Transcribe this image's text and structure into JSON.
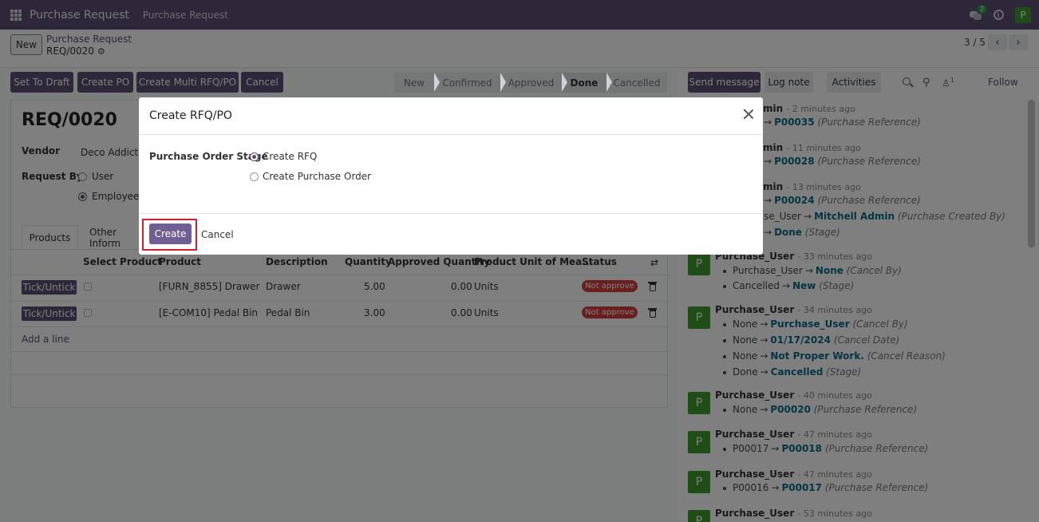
{
  "navbar": {
    "app_title": "Purchase Request",
    "menu_item": "Purchase Request",
    "chat_count": "2",
    "user_initial": "P"
  },
  "control": {
    "new_label": "New",
    "breadcrumb_parent": "Purchase Request",
    "breadcrumb_current": "REQ/0020",
    "pager": "3 / 5"
  },
  "actions": {
    "set_draft": "Set To Draft",
    "create_po": "Create PO",
    "create_multi": "Create Multi RFQ/PO",
    "cancel": "Cancel"
  },
  "stages": [
    "New",
    "Confirmed",
    "Approved",
    "Done",
    "Cancelled"
  ],
  "active_stage": "Done",
  "form": {
    "name": "REQ/0020",
    "vendor_label": "Vendor",
    "vendor_value": "Deco Addict",
    "request_by_label": "Request By",
    "request_by_options": [
      "User",
      "Employee"
    ],
    "request_by_selected": "Employee",
    "tabs": [
      "Products",
      "Other Inform"
    ]
  },
  "table": {
    "headers": [
      "Select Product",
      "Product",
      "Description",
      "Quantity",
      "Approved Quantity",
      "Product Unit of Mea...",
      "Status"
    ],
    "rows": [
      {
        "btn": "Tick/Untick",
        "product": "[FURN_8855] Drawer",
        "description": "Drawer",
        "quantity": "5.00",
        "approved": "0.00",
        "uom": "Units",
        "status": "Not approve"
      },
      {
        "btn": "Tick/Untick",
        "product": "[E-COM10] Pedal Bin",
        "description": "Pedal Bin",
        "quantity": "3.00",
        "approved": "0.00",
        "uom": "Units",
        "status": "Not approve"
      }
    ],
    "add_line": "Add a line"
  },
  "chatter": {
    "send_message": "Send message",
    "log_note": "Log note",
    "activities": "Activities",
    "follow": "Follow",
    "followers": "1",
    "messages": [
      {
        "author": "min",
        "time": "- 2 minutes ago",
        "tracks": [
          {
            "old": "",
            "new": "P00035",
            "field": "(Purchase Reference)"
          }
        ]
      },
      {
        "author": "min",
        "time": "- 11 minutes ago",
        "tracks": [
          {
            "old": "",
            "new": "P00028",
            "field": "(Purchase Reference)"
          }
        ]
      },
      {
        "author": "min",
        "time": "- 13 minutes ago",
        "tracks": [
          {
            "old": "",
            "new": "P00024",
            "field": "(Purchase Reference)"
          },
          {
            "old": "se_User",
            "new": "Mitchell Admin",
            "field": "(Purchase Created By)"
          },
          {
            "old": "",
            "new": "Done",
            "field": "(Stage)"
          }
        ]
      },
      {
        "author": "Purchase_User",
        "time": "- 33 minutes ago",
        "tracks": [
          {
            "old": "Purchase_User",
            "new": "None",
            "field": "(Cancel By)"
          },
          {
            "old": "Cancelled",
            "new": "New",
            "field": "(Stage)"
          }
        ]
      },
      {
        "author": "Purchase_User",
        "time": "- 34 minutes ago",
        "tracks": [
          {
            "old": "None",
            "new": "Purchase_User",
            "field": "(Cancel By)"
          },
          {
            "old": "None",
            "new": "01/17/2024",
            "field": "(Cancel Date)"
          },
          {
            "old": "None",
            "new": "Not Proper Work.",
            "field": "(Cancel Reason)"
          },
          {
            "old": "Done",
            "new": "Cancelled",
            "field": "(Stage)"
          }
        ]
      },
      {
        "author": "Purchase_User",
        "time": "- 40 minutes ago",
        "tracks": [
          {
            "old": "None",
            "new": "P00020",
            "field": "(Purchase Reference)"
          }
        ]
      },
      {
        "author": "Purchase_User",
        "time": "- 47 minutes ago",
        "tracks": [
          {
            "old": "P00017",
            "new": "P00018",
            "field": "(Purchase Reference)"
          }
        ]
      },
      {
        "author": "Purchase_User",
        "time": "- 47 minutes ago",
        "tracks": [
          {
            "old": "P00016",
            "new": "P00017",
            "field": "(Purchase Reference)"
          }
        ]
      },
      {
        "author": "Purchase_User",
        "time": "- 53 minutes ago",
        "tracks": []
      }
    ]
  },
  "modal": {
    "title": "Create RFQ/PO",
    "field_label": "Purchase Order Stage",
    "options": [
      "Create RFQ",
      "Create Purchase Order"
    ],
    "selected": "Create RFQ",
    "create_label": "Create",
    "cancel_label": "Cancel"
  },
  "colors": {
    "brand": "#5c4c72",
    "highlight": "#d0212b",
    "status_red": "#d23f3a",
    "avatar_green": "#3f9b2c",
    "link": "#0b6a85"
  }
}
